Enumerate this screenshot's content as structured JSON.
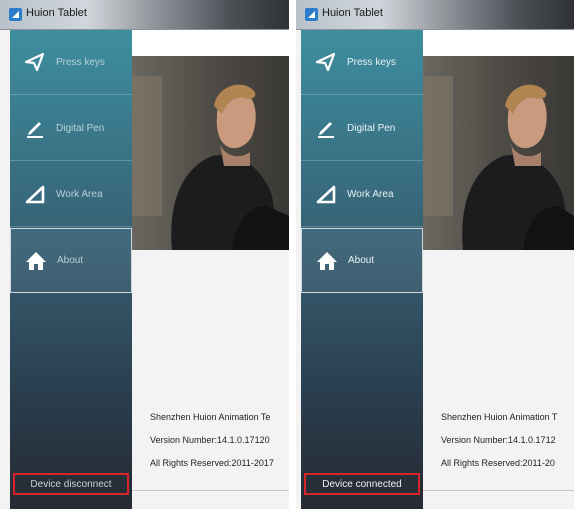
{
  "windows": [
    {
      "title": "Huion Tablet",
      "nav": [
        {
          "label": "Press keys",
          "icon": "send-arrow-icon"
        },
        {
          "label": "Digital Pen",
          "icon": "pen-icon"
        },
        {
          "label": "Work Area",
          "icon": "triangle-icon"
        },
        {
          "label": "About",
          "icon": "home-icon"
        }
      ],
      "active_item": "About",
      "status": "Device disconnect",
      "info": [
        "Shenzhen Huion Animation Te",
        "Version Number:14.1.0.17120",
        "All Rights Reserved:2011-2017"
      ]
    },
    {
      "title": "Huion Tablet",
      "nav": [
        {
          "label": "Press keys",
          "icon": "send-arrow-icon"
        },
        {
          "label": "Digital Pen",
          "icon": "pen-icon"
        },
        {
          "label": "Work Area",
          "icon": "triangle-icon"
        },
        {
          "label": "About",
          "icon": "home-icon"
        }
      ],
      "active_item": "About",
      "status": "Device connected",
      "info": [
        "Shenzhen Huion Animation T",
        "Version Number:14.1.0.1712",
        "All Rights Reserved:2011-20"
      ]
    }
  ],
  "colors": {
    "accent": "#3e8e9f",
    "status_border": "#d6262a"
  }
}
